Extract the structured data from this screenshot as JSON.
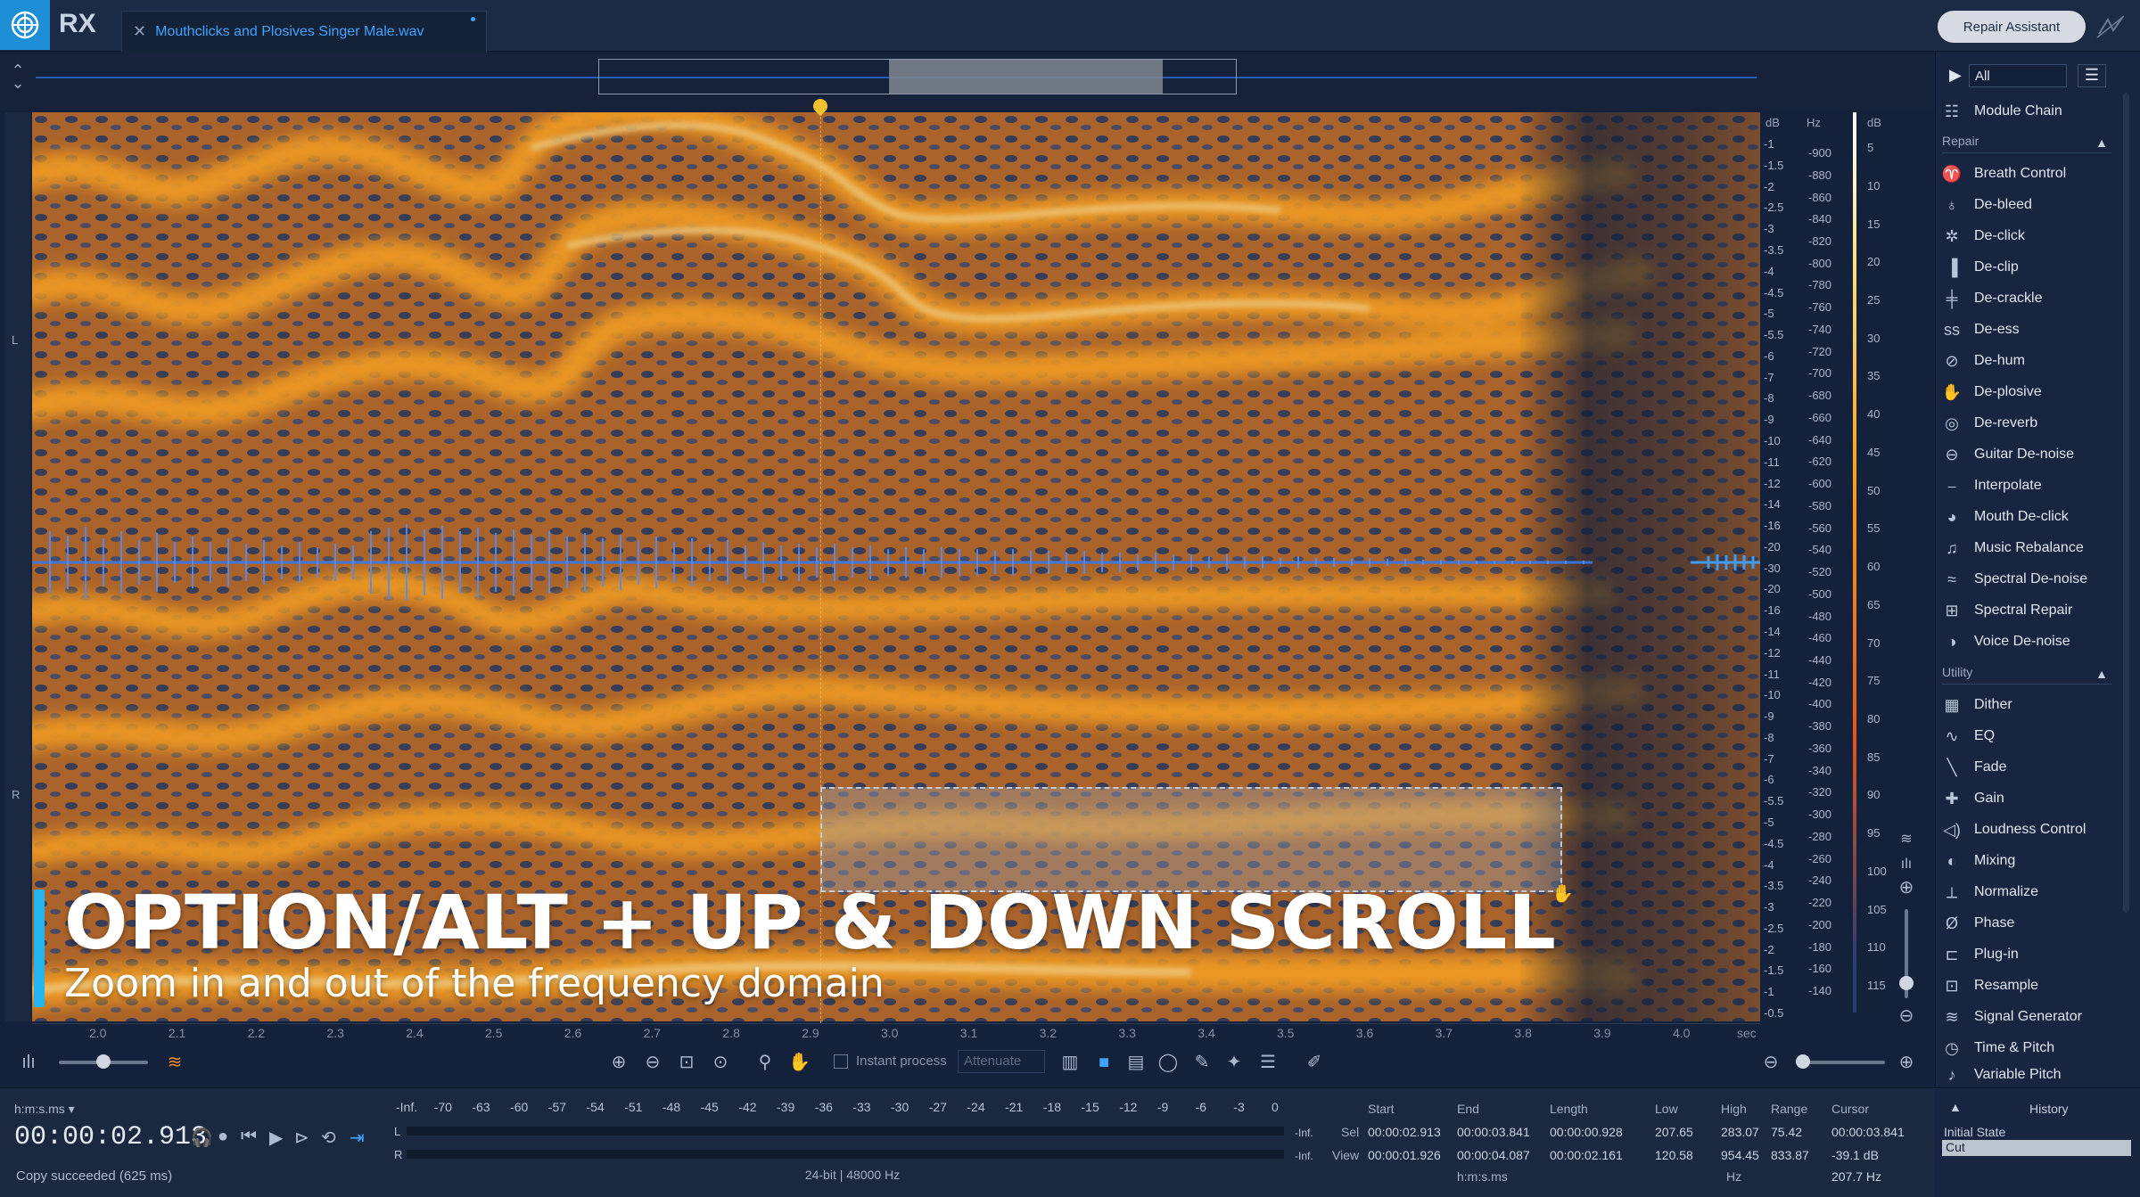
{
  "app": {
    "name": "RX",
    "file_tab": "Mouthclicks and Plosives Singer Male.wav",
    "repair_assistant": "Repair Assistant"
  },
  "channels": {
    "left": "L",
    "right": "R"
  },
  "overlay": {
    "title": "OPTION/ALT + UP & DOWN SCROLL",
    "subtitle": "Zoom in and out of the frequency domain"
  },
  "scale": {
    "db_head": "dB",
    "hz_head": "Hz",
    "color_db_head": "dB",
    "db_ticks": [
      "-1",
      "-1.5",
      "-2",
      "-2.5",
      "-3",
      "-3.5",
      "-4",
      "-4.5",
      "-5",
      "-5.5",
      "-6",
      "-7",
      "-8",
      "-9",
      "-10",
      "-11",
      "-12",
      "-14",
      "-16",
      "-20",
      "-30",
      "-20",
      "-16",
      "-14",
      "-12",
      "-11",
      "-10",
      "-9",
      "-8",
      "-7",
      "-6",
      "-5.5",
      "-5",
      "-4.5",
      "-4",
      "-3.5",
      "-3",
      "-2.5",
      "-2",
      "-1.5",
      "-1",
      "-0.5"
    ],
    "hz_ticks": [
      "-900",
      "-880",
      "-860",
      "-840",
      "-820",
      "-800",
      "-780",
      "-760",
      "-740",
      "-720",
      "-700",
      "-680",
      "-660",
      "-640",
      "-620",
      "-600",
      "-580",
      "-560",
      "-540",
      "-520",
      "-500",
      "-480",
      "-460",
      "-440",
      "-420",
      "-400",
      "-380",
      "-360",
      "-340",
      "-320",
      "-300",
      "-280",
      "-260",
      "-240",
      "-220",
      "-200",
      "-180",
      "-160",
      "-140"
    ],
    "color_ticks": [
      "5",
      "10",
      "15",
      "20",
      "25",
      "30",
      "35",
      "40",
      "45",
      "50",
      "55",
      "60",
      "65",
      "70",
      "75",
      "80",
      "85",
      "90",
      "95",
      "100",
      "105",
      "110",
      "115"
    ]
  },
  "timeline": {
    "ticks": [
      "2.0",
      "2.1",
      "2.2",
      "2.3",
      "2.4",
      "2.5",
      "2.6",
      "2.7",
      "2.8",
      "2.9",
      "3.0",
      "3.1",
      "3.2",
      "3.3",
      "3.4",
      "3.5",
      "3.6",
      "3.7",
      "3.8",
      "3.9",
      "4.0"
    ],
    "unit": "sec"
  },
  "toolbar": {
    "instant_process": "Instant process",
    "attenuate": "Attenuate"
  },
  "transport": {
    "time_format": "h:m:s.ms ▾",
    "time": "00:00:02.913",
    "status": "Copy succeeded (625 ms)"
  },
  "meter": {
    "scale": [
      "-Inf.",
      "-70",
      "-63",
      "-60",
      "-57",
      "-54",
      "-51",
      "-48",
      "-45",
      "-42",
      "-39",
      "-36",
      "-33",
      "-30",
      "-27",
      "-24",
      "-21",
      "-18",
      "-15",
      "-12",
      "-9",
      "-6",
      "-3",
      "0"
    ],
    "left": "L",
    "right": "R",
    "peak_l": "-Inf.",
    "peak_r": "-Inf.",
    "format": "24-bit | 48000 Hz"
  },
  "selection": {
    "headers": {
      "start": "Start",
      "end": "End",
      "length": "Length",
      "low": "Low",
      "high": "High",
      "range": "Range",
      "cursor": "Cursor"
    },
    "sel": {
      "label": "Sel",
      "start": "00:00:02.913",
      "end": "00:00:03.841",
      "length": "00:00:00.928",
      "low": "207.65",
      "high": "283.07",
      "range": "75.42",
      "cursor": "00:00:03.841"
    },
    "view": {
      "label": "View",
      "start": "00:00:01.926",
      "end": "00:00:04.087",
      "length": "00:00:02.161",
      "low": "120.58",
      "high": "954.45",
      "range": "833.87",
      "cursor_db": "-39.1 dB"
    },
    "time_unit": "h:m:s.ms",
    "freq_unit": "Hz",
    "cursor_hz": "207.7 Hz"
  },
  "sidebar": {
    "filter": "All",
    "module_chain": "Module Chain",
    "repair_head": "Repair",
    "repair": [
      "Breath Control",
      "De-bleed",
      "De-click",
      "De-clip",
      "De-crackle",
      "De-ess",
      "De-hum",
      "De-plosive",
      "De-reverb",
      "Guitar De-noise",
      "Interpolate",
      "Mouth De-click",
      "Music Rebalance",
      "Spectral De-noise",
      "Spectral Repair",
      "Voice De-noise"
    ],
    "utility_head": "Utility",
    "utility": [
      "Dither",
      "EQ",
      "Fade",
      "Gain",
      "Loudness Control",
      "Mixing",
      "Normalize",
      "Phase",
      "Plug-in",
      "Resample",
      "Signal Generator",
      "Time & Pitch",
      "Variable Pitch"
    ]
  },
  "history": {
    "title": "History",
    "items": [
      "Initial State",
      "Cut"
    ]
  },
  "colors": {
    "accent": "#3ea3ff",
    "overlay_bar": "#23b5f0",
    "playhead": "#f2c12e"
  }
}
